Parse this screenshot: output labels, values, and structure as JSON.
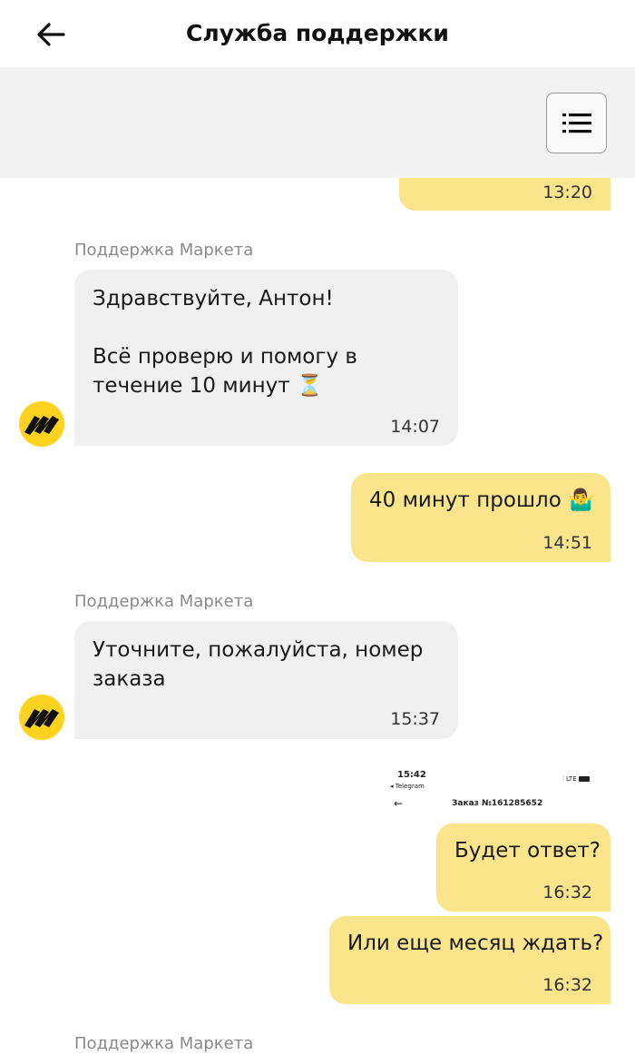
{
  "header": {
    "title": "Служба поддержки",
    "back_icon": "arrow-left-icon",
    "menu_icon": "list-menu-icon"
  },
  "colors": {
    "incoming_bubble": "#f0f0f0",
    "outgoing_bubble": "#fae58d",
    "toolbar_bg": "#f2f2f2",
    "avatar_yellow": "#ffd21f"
  },
  "messages": [
    {
      "direction": "out",
      "text": "",
      "time": "13:20"
    },
    {
      "direction": "in",
      "sender": "Поддержка Маркета",
      "text": "Здравствуйте, Антон!\n\nВсё проверю и помогу в\nтечение 10 минут ⏳",
      "time": "14:07"
    },
    {
      "direction": "out",
      "text": "40 минут прошло 🤷‍♂️",
      "time": "14:51"
    },
    {
      "direction": "in",
      "sender": "Поддержка Маркета",
      "text": "Уточните, пожалуйста, номер\nзаказа",
      "time": "15:37"
    },
    {
      "direction": "out",
      "text": "Будет ответ?",
      "time": "16:32"
    },
    {
      "direction": "out",
      "text": "Или еще месяц ждать?",
      "time": "16:32"
    },
    {
      "direction": "in",
      "sender": "Поддержка Маркета"
    }
  ],
  "screenshot_preview": {
    "time": "15:42",
    "app": "◂ Telegram",
    "status": "LTE",
    "order_title": "Заказ №161285652"
  }
}
